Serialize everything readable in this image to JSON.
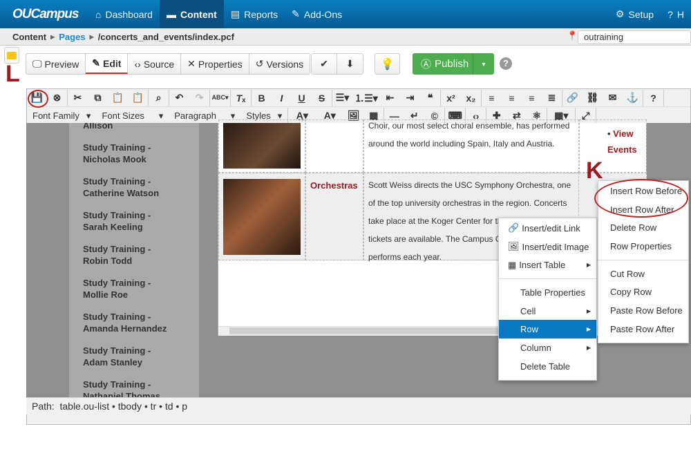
{
  "nav": {
    "logo": "OUCampus",
    "items": [
      "Dashboard",
      "Content",
      "Reports",
      "Add-Ons"
    ],
    "setup": "Setup",
    "help": "H"
  },
  "breadcrumb": {
    "root": "Content",
    "pages": "Pages",
    "path": "/concerts_and_events/index.pcf"
  },
  "site": {
    "value": "outraining"
  },
  "view_tabs": [
    "Preview",
    "Edit",
    "Source",
    "Properties",
    "Versions"
  ],
  "publish": {
    "label": "Publish"
  },
  "toolbar": {
    "dropdowns": [
      "Font Family",
      "Font Sizes",
      "Paragraph",
      "Styles"
    ]
  },
  "sidebar": {
    "items": [
      "Allison",
      "Study Training - Nicholas Mook",
      "Study Training - Catherine Watson",
      "Study Training - Sarah Keeling",
      "Study Training - Robin Todd",
      "Study Training - Mollie Roe",
      "Study Training - Amanda Hernandez",
      "Study Training - Adam Stanley",
      "Study Training - Nathaniel Thomas"
    ]
  },
  "table": {
    "row1_text": "Choir, our most select choral ensemble, has performed around the world including Spain, Italy and Austria.",
    "view_events": "View Events",
    "row2_title": "Orchestras",
    "row2_text": "Scott Weiss directs the USC Symphony Orchestra, one of the top university orchestras in the region. Concerts take place at the Koger Center for the Arts. Season tickets are available. The Campus Orchestra also performs each year."
  },
  "context_menu": {
    "items": [
      "Insert/edit Link",
      "Insert/edit Image",
      "Insert Table",
      "Table Properties",
      "Cell",
      "Row",
      "Column",
      "Delete Table"
    ]
  },
  "row_submenu": {
    "items": [
      "Insert Row Before",
      "Insert Row After",
      "Delete Row",
      "Row Properties",
      "Cut Row",
      "Copy Row",
      "Paste Row Before",
      "Paste Row After"
    ]
  },
  "annotations": {
    "l": "L",
    "k": "K"
  },
  "path_bar": {
    "label": "Path:",
    "value": "table.ou-list • tbody • tr • td • p"
  },
  "colors": {
    "nav": "#0a6aa8",
    "publish": "#4cae4c",
    "annotation": "#9b1b1e",
    "menu_highlight": "#0a78c2"
  }
}
